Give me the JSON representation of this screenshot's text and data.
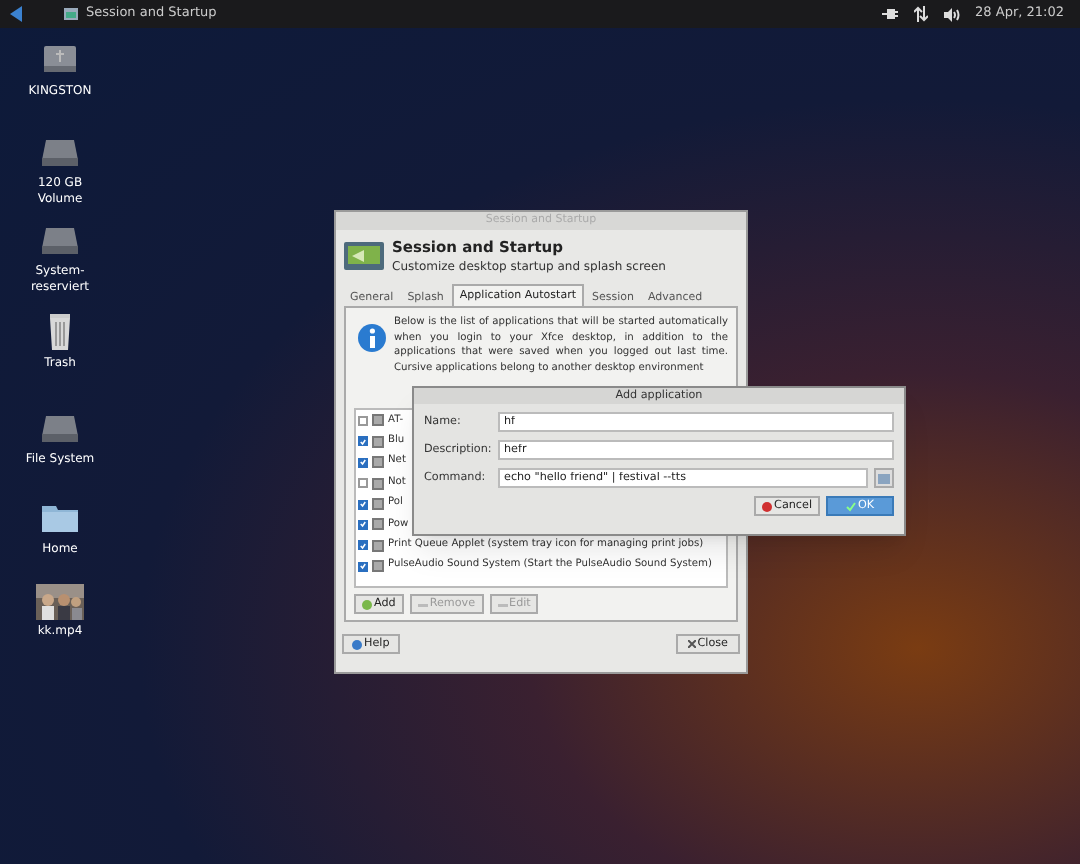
{
  "taskbar": {
    "app_title": "Session and Startup",
    "clock": "28 Apr, 21:02"
  },
  "desktop_icons": [
    {
      "label": "KINGSTON",
      "kind": "usb"
    },
    {
      "label": "120 GB Volume",
      "kind": "drive"
    },
    {
      "label": "System-reserviert",
      "kind": "drive"
    },
    {
      "label": "Trash",
      "kind": "trash"
    },
    {
      "label": "File System",
      "kind": "drive"
    },
    {
      "label": "Home",
      "kind": "folder"
    },
    {
      "label": "kk.mp4",
      "kind": "video"
    }
  ],
  "main_window": {
    "title": "Session and Startup",
    "heading": "Session and Startup",
    "subtitle": "Customize desktop startup and splash screen",
    "tabs": [
      {
        "label": "General",
        "selected": false
      },
      {
        "label": "Splash",
        "selected": false
      },
      {
        "label": "Application Autostart",
        "selected": true
      },
      {
        "label": "Session",
        "selected": false
      },
      {
        "label": "Advanced",
        "selected": false
      }
    ],
    "info_text": "Below is the list of applications that will be started automatically when you login to your Xfce desktop, in addition to the applications that were saved when you logged out last time. Cursive applications belong to another desktop environment",
    "autostart_items": [
      {
        "label": "AT-",
        "checked": false
      },
      {
        "label": "Blu",
        "checked": true
      },
      {
        "label": "Net",
        "checked": true
      },
      {
        "label": "Not",
        "checked": false
      },
      {
        "label": "Pol",
        "checked": true
      },
      {
        "label": "Pow",
        "checked": true
      },
      {
        "label": "Print Queue Applet (system tray icon for managing print jobs)",
        "checked": true
      },
      {
        "label": "PulseAudio Sound System (Start the PulseAudio Sound System)",
        "checked": true
      }
    ],
    "list_buttons": [
      {
        "label": "Add",
        "disabled": false
      },
      {
        "label": "Remove",
        "disabled": true
      },
      {
        "label": "Edit",
        "disabled": true
      }
    ],
    "help": "Help",
    "close": "Close"
  },
  "dialog": {
    "title": "Add application",
    "fields": [
      {
        "label": "Name:",
        "value": "hf"
      },
      {
        "label": "Description:",
        "value": "hefr"
      },
      {
        "label": "Command:",
        "value": "echo \"hello friend\" | festival --tts"
      }
    ],
    "cancel": "Cancel",
    "ok": "OK"
  }
}
